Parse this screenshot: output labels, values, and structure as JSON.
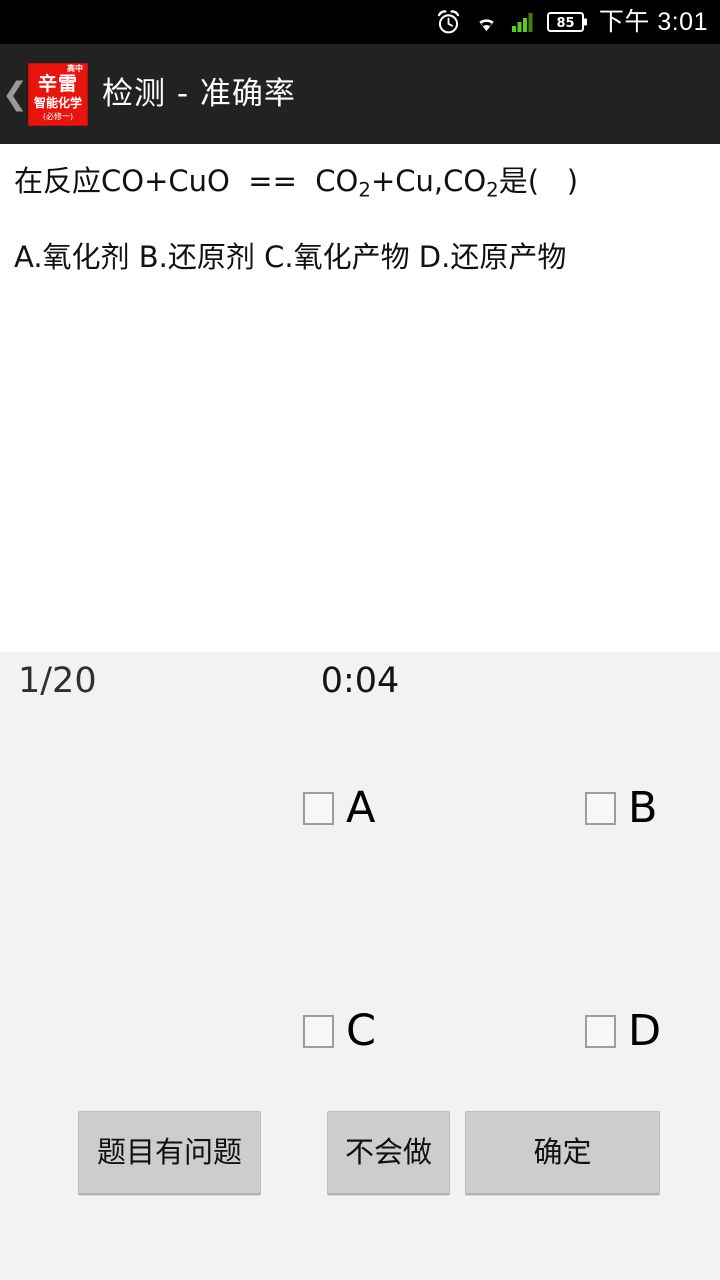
{
  "status_bar": {
    "time": "下午 3:01",
    "battery_level": "85",
    "icons": [
      "alarm-clock-icon",
      "wifi-icon",
      "cellular-signal-icon",
      "battery-icon"
    ]
  },
  "header": {
    "back_icon": "back-chevron-icon",
    "title": "检测 - 准确率",
    "logo": {
      "superscript": "高中",
      "main": "辛雷",
      "sub": "智能化学",
      "footer": "(必修一)",
      "color": "#e8150f"
    }
  },
  "question": {
    "stem_prefix": "在反应CO+CuO  ==  CO",
    "stem_sub1": "2",
    "stem_middle": "+Cu,CO",
    "stem_sub2": "2",
    "stem_suffix": "是(   )",
    "options_line": "A.氧化剂      B.还原剂      C.氧化产物      D.还原产物"
  },
  "answer_panel": {
    "progress": "1/20",
    "timer": "0:04",
    "choices": [
      {
        "key": "A",
        "checked": false
      },
      {
        "key": "B",
        "checked": false
      },
      {
        "key": "C",
        "checked": false
      },
      {
        "key": "D",
        "checked": false
      }
    ],
    "buttons": {
      "report": "题目有问题",
      "unknown": "不会做",
      "confirm": "确定"
    }
  },
  "colors": {
    "status_bar_bg": "#000000",
    "header_bg": "#222222",
    "content_bg": "#ffffff",
    "panel_bg": "#f2f2f2",
    "button_bg": "#cdcdcd",
    "signal_green": "#5bcc22"
  }
}
